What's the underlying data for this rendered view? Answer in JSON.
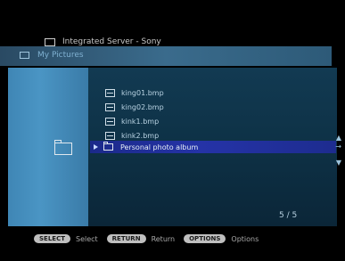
{
  "header": {
    "server_title": "Integrated Server - Sony",
    "current_folder": "My Pictures",
    "icons": {
      "server": "monitor-icon",
      "folder_tv": "tv-icon"
    }
  },
  "file_list": [
    {
      "name": "king01.bmp",
      "icon": "image-icon"
    },
    {
      "name": "king02.bmp",
      "icon": "image-icon"
    },
    {
      "name": "kink1.bmp",
      "icon": "image-icon"
    },
    {
      "name": "kink2.bmp",
      "icon": "image-icon"
    }
  ],
  "selected_item": {
    "name": "Personal photo album",
    "icon": "folder-icon"
  },
  "navigation": {
    "up": "▲",
    "right": "→",
    "down": "▼"
  },
  "page_indicator": "5 / 5",
  "hints": [
    {
      "button": "SELECT",
      "label": "Select"
    },
    {
      "button": "RETURN",
      "label": "Return"
    },
    {
      "button": "OPTIONS",
      "label": "Options"
    }
  ],
  "colors": {
    "background": "#000000",
    "left_panel": "#4a95c4",
    "main_panel": "#0e3247",
    "highlight": "#2533a7",
    "header_bar": "#3a6b8c",
    "text": "#b9d3e3"
  }
}
